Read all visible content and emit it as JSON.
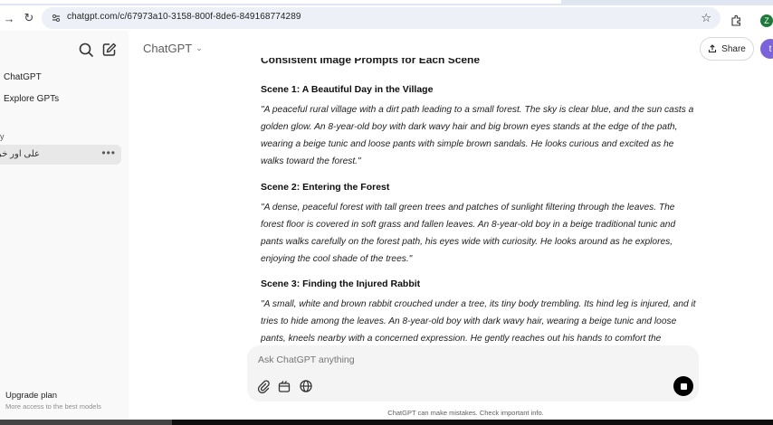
{
  "browser": {
    "url": "chatgpt.com/c/67973a10-3158-800f-8de6-849168774289",
    "profile_initial": "Z"
  },
  "sidebar": {
    "items": [
      {
        "label": "ChatGPT"
      },
      {
        "label": "Explore GPTs"
      }
    ],
    "section_label": "y",
    "chat_item": "علی اور خرگوش",
    "more": "•••",
    "upgrade_title": "Upgrade plan",
    "upgrade_subtitle": "More access to the best models"
  },
  "header": {
    "model": "ChatGPT",
    "share_label": "Share",
    "avatar_initial": "t"
  },
  "conversation": {
    "cut_heading": "Consistent Image Prompts for Each Scene",
    "scenes": [
      {
        "title": "Scene 1: A Beautiful Day in the Village",
        "text": "\"A peaceful rural village with a dirt path leading to a small forest. The sky is clear blue, and the sun casts a golden glow. An 8-year-old boy with dark wavy hair and big brown eyes stands at the edge of the path, wearing a beige tunic and loose pants with simple brown sandals. He looks curious and excited as he walks toward the forest.\""
      },
      {
        "title": "Scene 2: Entering the Forest",
        "text": "\"A dense, peaceful forest with tall green trees and patches of sunlight filtering through the leaves. The forest floor is covered in soft grass and fallen leaves. An 8-year-old boy in a beige traditional tunic and pants walks carefully on the forest path, his eyes wide with curiosity. He looks around as he explores, enjoying the cool shade of the trees.\""
      },
      {
        "title": "Scene 3: Finding the Injured Rabbit",
        "text": "\"A small, white and brown rabbit crouched under a tree, its tiny body trembling. Its hind leg is injured, and it tries to hide among the leaves. An 8-year-old boy with dark wavy hair, wearing a beige tunic and loose pants, kneels nearby with a concerned expression. He gently reaches out his hands to comfort the"
      }
    ]
  },
  "composer": {
    "placeholder": "Ask ChatGPT anything"
  },
  "footer": {
    "disclaimer": "ChatGPT can make mistakes. Check important info."
  }
}
